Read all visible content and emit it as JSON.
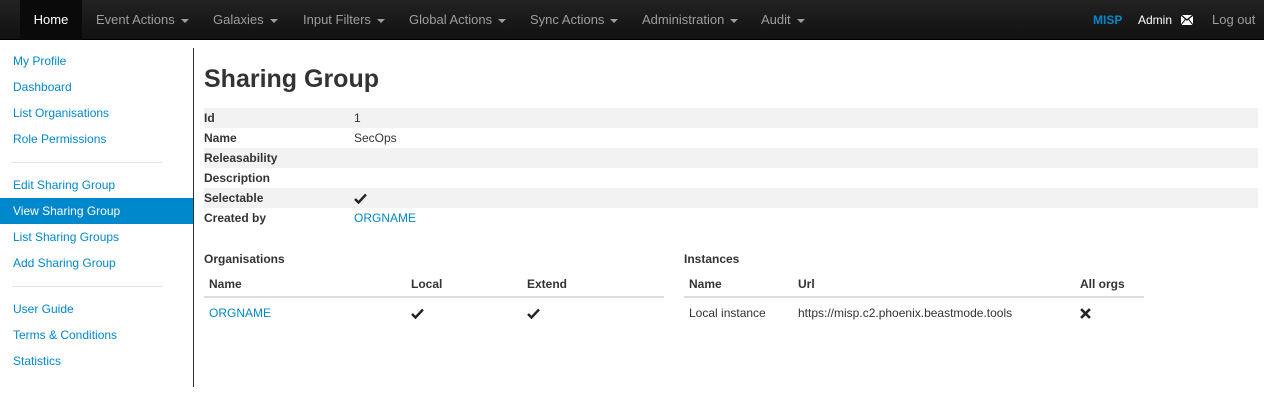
{
  "navbar": {
    "items": [
      {
        "label": "Home"
      },
      {
        "label": "Event Actions"
      },
      {
        "label": "Galaxies"
      },
      {
        "label": "Input Filters"
      },
      {
        "label": "Global Actions"
      },
      {
        "label": "Sync Actions"
      },
      {
        "label": "Administration"
      },
      {
        "label": "Audit"
      }
    ],
    "brand": "MISP",
    "user": "Admin",
    "logout": "Log out"
  },
  "sidebar": {
    "groups": [
      [
        "My Profile",
        "Dashboard",
        "List Organisations",
        "Role Permissions"
      ],
      [
        "Edit Sharing Group",
        "View Sharing Group",
        "List Sharing Groups",
        "Add Sharing Group"
      ],
      [
        "User Guide",
        "Terms & Conditions",
        "Statistics"
      ]
    ],
    "active": "View Sharing Group"
  },
  "page": {
    "title": "Sharing Group",
    "fields": [
      {
        "key": "Id",
        "value": "1"
      },
      {
        "key": "Name",
        "value": "SecOps"
      },
      {
        "key": "Releasability",
        "value": ""
      },
      {
        "key": "Description",
        "value": ""
      },
      {
        "key": "Selectable",
        "value": "",
        "icon": "check-icon"
      },
      {
        "key": "Created by",
        "value": "ORGNAME",
        "link": true
      }
    ]
  },
  "organisations": {
    "title": "Organisations",
    "headers": [
      "Name",
      "Local",
      "Extend"
    ],
    "rows": [
      {
        "name": "ORGNAME",
        "local": "check-icon",
        "extend": "check-icon"
      }
    ]
  },
  "instances": {
    "title": "Instances",
    "headers": [
      "Name",
      "Url",
      "All orgs"
    ],
    "rows": [
      {
        "name": "Local instance",
        "url": "https://misp.c2.phoenix.beastmode.tools",
        "all_orgs": "x-icon"
      }
    ]
  },
  "colors": {
    "link": "#0088cc",
    "navbar": "#1b1b1b",
    "stripe": "#f2f2f2"
  }
}
